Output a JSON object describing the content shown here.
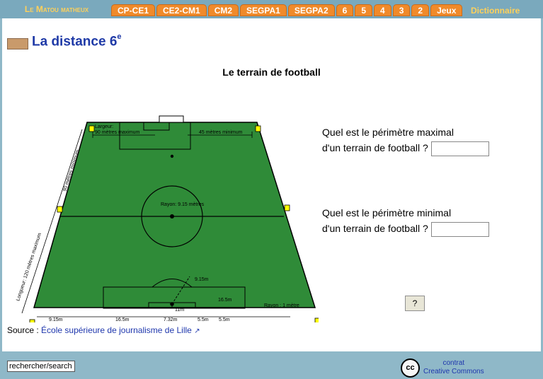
{
  "top_nav": {
    "brand": "Le Matou matheux",
    "tabs": [
      "CP-CE1",
      "CE2-CM1",
      "CM2",
      "SEGPA1",
      "SEGPA2",
      "6",
      "5",
      "4",
      "3",
      "2",
      "Jeux"
    ],
    "dictionary": "Dictionnaire"
  },
  "page": {
    "title": "La distance 6",
    "title_sup": "e",
    "heading": "Le terrain de football",
    "questions": [
      {
        "line1": "Quel est le périmètre maximal",
        "line2": "d'un terrain de football ?"
      },
      {
        "line1": "Quel est le périmètre minimal",
        "line2": "d'un terrain de football ?"
      }
    ],
    "help_button": "?",
    "source_label": "Source :",
    "source_link": "École supérieure de journalisme de Lille",
    "field_labels": {
      "largeur": "Largeur:",
      "largeur_max": "90 mètres maximum",
      "largeur_min": "45 mètres minimum",
      "longueur_min": "90 mètres minimum",
      "longueur_max": "Longueur: 120 mètres maximum",
      "rayon_center": "Rayon: 9.15 mètres",
      "rayon_corner": "Rayon : 1 mètre",
      "m915_arc": "9.15m",
      "m165_side": "16.5m",
      "m11": "11m",
      "m55": "5.5m",
      "b915": "9.15m",
      "b165": "16.5m",
      "b732": "7.32m",
      "b55": "5.5m"
    }
  },
  "footer": {
    "search": "rechercher/search",
    "cc_icon": "cc",
    "cc_line1": "contrat",
    "cc_line2": "Creative Commons"
  }
}
